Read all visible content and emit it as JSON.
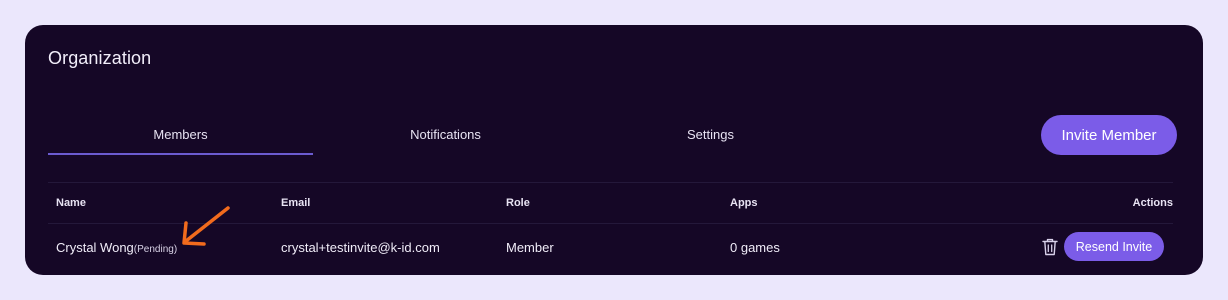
{
  "page": {
    "title": "Organization"
  },
  "tabs": [
    {
      "label": "Members",
      "active": true
    },
    {
      "label": "Notifications"
    },
    {
      "label": "Settings"
    }
  ],
  "invite_button": {
    "label": "Invite Member"
  },
  "table": {
    "headers": {
      "name": "Name",
      "email": "Email",
      "role": "Role",
      "apps": "Apps",
      "actions": "Actions"
    },
    "rows": [
      {
        "name": "Crystal Wong",
        "status": "(Pending)",
        "email": "crystal+testinvite@k-id.com",
        "role": "Member",
        "apps": "0 games",
        "delete_icon": "trash-icon",
        "resend_label": "Resend Invite"
      }
    ]
  },
  "annotation": {
    "icon": "arrow-icon",
    "color": "#f26b1d"
  },
  "colors": {
    "accent": "#7b5ce8",
    "panel": "#150726",
    "background": "#ebe7fc"
  }
}
